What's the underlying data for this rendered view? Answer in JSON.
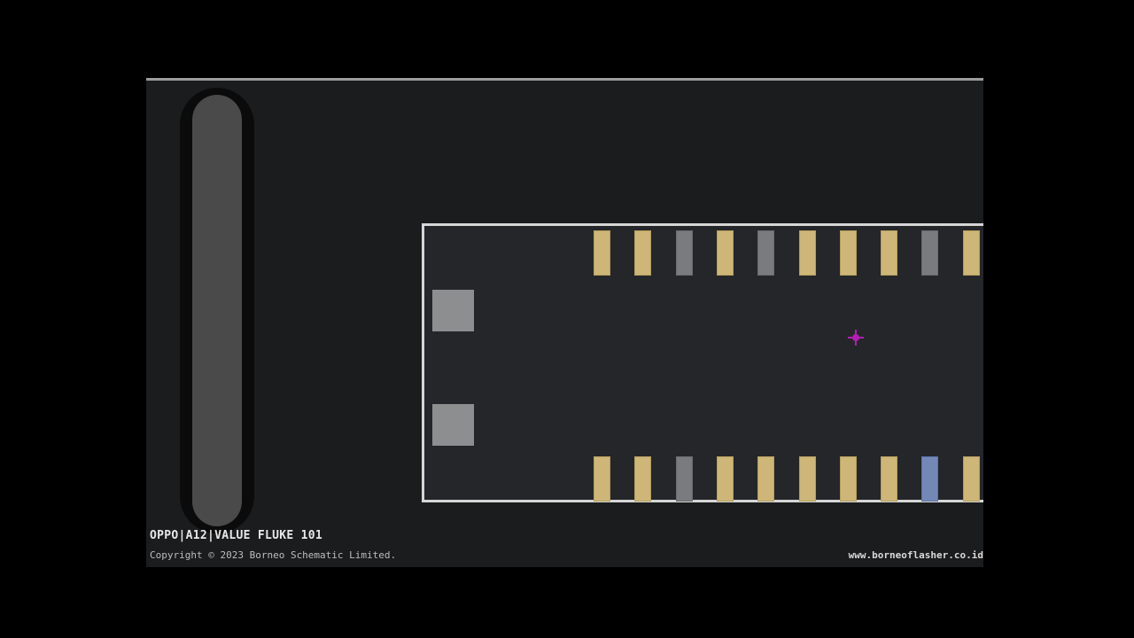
{
  "viewer": {
    "title": "OPPO|A12|VALUE FLUKE 101",
    "copyright": "Copyright © 2023 Borneo Schematic Limited.",
    "website": "www.borneoflasher.co.id"
  },
  "colors": {
    "background": "#000000",
    "canvas": "#1b1c1e",
    "gold_pin": "#cdb677",
    "gray_pin": "#7a7b7e",
    "blue_pin": "#7388b6",
    "cursor": "#b21fb2"
  },
  "pins_top": [
    "gold",
    "gold",
    "gray",
    "gold",
    "gray",
    "gold",
    "gold",
    "gold",
    "gray",
    "gold"
  ],
  "pins_bottom": [
    "gold",
    "gold",
    "gray",
    "gold",
    "gold",
    "gold",
    "gold",
    "gold",
    "blue",
    "gold"
  ],
  "icons": {
    "cursor": "crosshair-icon"
  }
}
